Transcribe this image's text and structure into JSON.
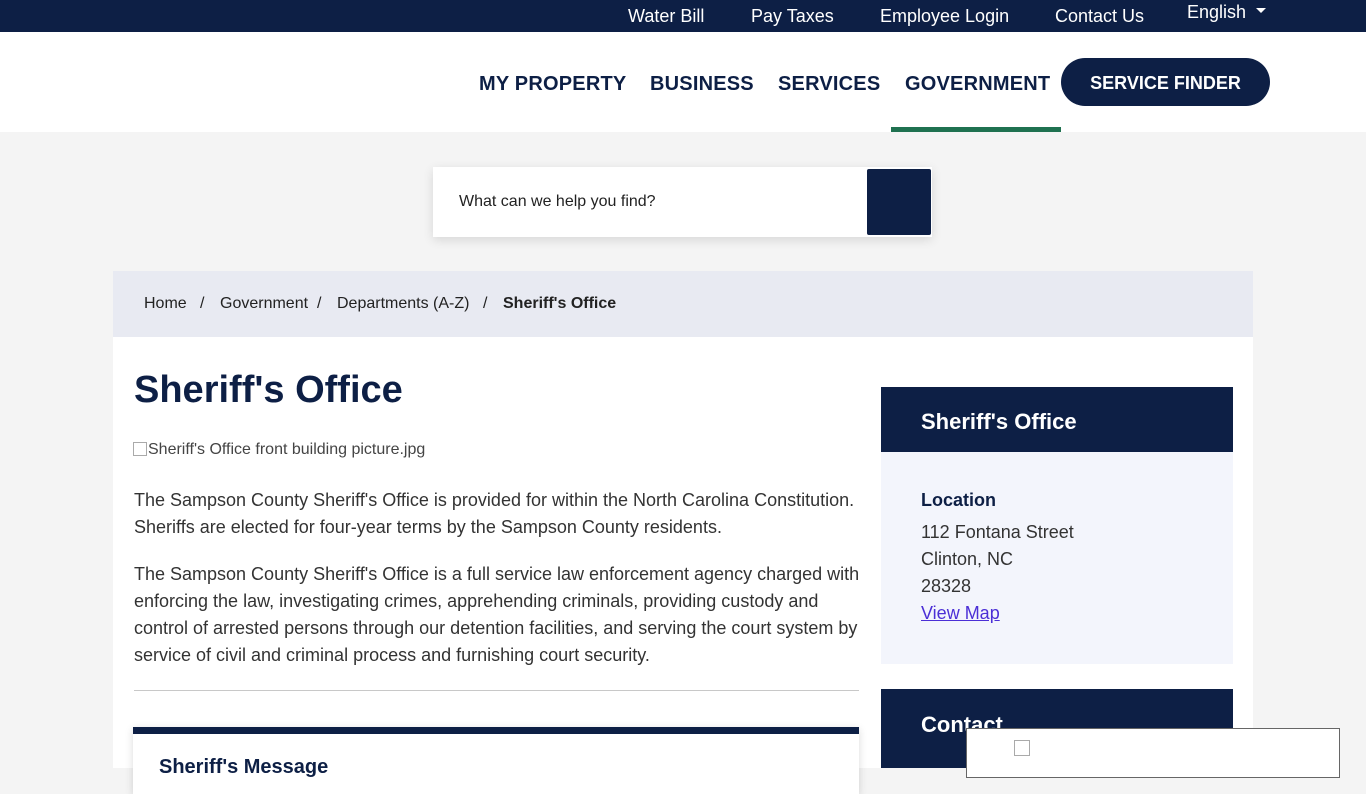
{
  "topbar": {
    "links": [
      "Water Bill",
      "Pay Taxes",
      "Employee Login",
      "Contact Us"
    ],
    "language": "English"
  },
  "nav": {
    "items": [
      "MY PROPERTY",
      "BUSINESS",
      "SERVICES",
      "GOVERNMENT"
    ],
    "active": "GOVERNMENT",
    "service_finder": "SERVICE FINDER"
  },
  "search": {
    "placeholder": "What can we help you find?",
    "icon": "search-icon"
  },
  "breadcrumb": {
    "items": [
      "Home",
      "Government",
      "Departments (A-Z)",
      "Sheriff's Office"
    ]
  },
  "main": {
    "title": "Sheriff's Office",
    "image_alt": "Sheriff's Office front building picture.jpg",
    "paragraphs": [
      "The Sampson County Sheriff's Office is provided for within the North Carolina Constitution. Sheriffs are elected for four-year terms by the Sampson County residents.",
      "The Sampson County Sheriff's Office is a full service law enforcement agency charged with enforcing the law, investigating crimes, apprehending criminals, providing custody and control of arrested persons through our detention facilities, and serving the court system by service of civil and criminal process and furnishing court security."
    ],
    "message_title": "Sheriff's Message"
  },
  "sidebar": {
    "title": "Sheriff's Office",
    "location_label": "Location",
    "address": [
      "112 Fontana Street",
      "Clinton, NC",
      "28328"
    ],
    "map_link": "View Map",
    "contact_title": "Contact"
  },
  "colors": {
    "navy": "#0d1f45",
    "active_underline": "#1f7150",
    "breadcrumb_bg": "#e8eaf2",
    "link": "#4b2fd6"
  }
}
